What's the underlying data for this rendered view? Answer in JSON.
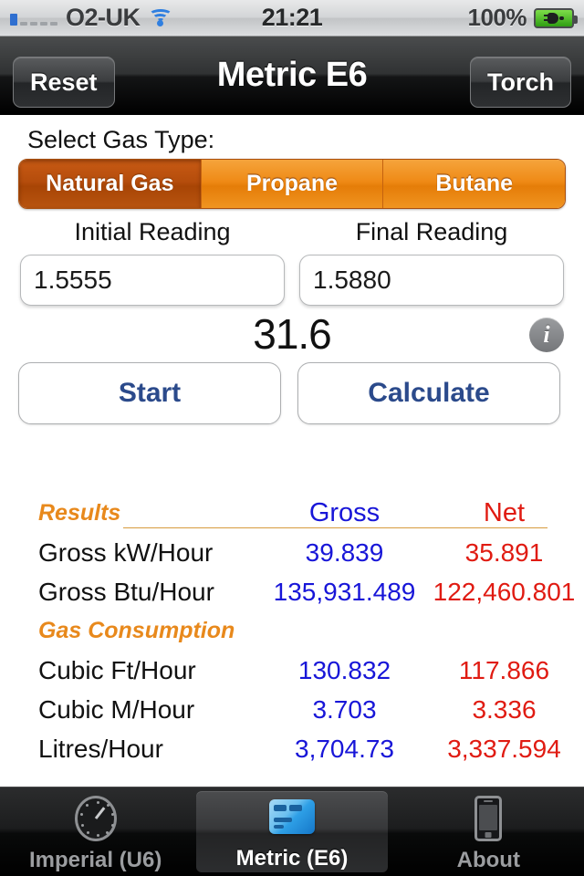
{
  "statusbar": {
    "carrier": "O2-UK",
    "time": "21:21",
    "battery_percent": "100%",
    "signal_bars_filled": 1,
    "signal_bars_total": 5
  },
  "navbar": {
    "title": "Metric E6",
    "left_button": "Reset",
    "right_button": "Torch"
  },
  "gas_type": {
    "label": "Select Gas Type:",
    "options": [
      "Natural Gas",
      "Propane",
      "Butane"
    ],
    "selected": "Natural Gas"
  },
  "readings": {
    "initial_label": "Initial Reading",
    "initial_value": "1.5555",
    "final_label": "Final Reading",
    "final_value": "1.5880"
  },
  "timer": {
    "value": "31.6",
    "info_glyph": "i"
  },
  "actions": {
    "start": "Start",
    "calculate": "Calculate"
  },
  "results": {
    "title": "Results",
    "col_gross": "Gross",
    "col_net": "Net",
    "section_gas_consumption": "Gas Consumption",
    "rows_energy": [
      {
        "label": "Gross kW/Hour",
        "gross": "39.839",
        "net": "35.891"
      },
      {
        "label": "Gross Btu/Hour",
        "gross": "135,931.489",
        "net": "122,460.801"
      }
    ],
    "rows_consumption": [
      {
        "label": "Cubic Ft/Hour",
        "gross": "130.832",
        "net": "117.866"
      },
      {
        "label": "Cubic M/Hour",
        "gross": "3.703",
        "net": "3.336"
      },
      {
        "label": "Litres/Hour",
        "gross": "3,704.73",
        "net": "3,337.594"
      }
    ],
    "color_gross": "#1816d8",
    "color_net": "#e01b12",
    "color_heading": "#e8891c"
  },
  "tabbar": {
    "tabs": [
      {
        "label": "Imperial (U6)",
        "icon": "gauge-icon",
        "active": false
      },
      {
        "label": "Metric (E6)",
        "icon": "card-icon",
        "active": true
      },
      {
        "label": "About",
        "icon": "phone-icon",
        "active": false
      }
    ]
  }
}
